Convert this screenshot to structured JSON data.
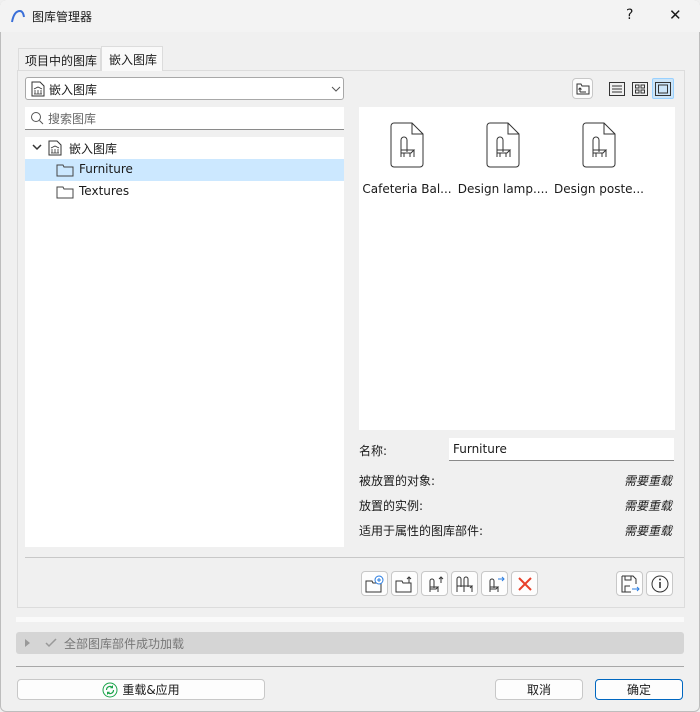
{
  "window": {
    "title": "图库管理器",
    "help": "?",
    "close": "✕"
  },
  "tabs": [
    {
      "label": "项目中的图库",
      "active": false
    },
    {
      "label": "嵌入图库",
      "active": true
    }
  ],
  "library_select": {
    "value": "嵌入图库"
  },
  "search": {
    "placeholder": "搜索图库"
  },
  "tree": {
    "root": "嵌入图库",
    "children": [
      {
        "label": "Furniture",
        "selected": true
      },
      {
        "label": "Textures",
        "selected": false
      }
    ]
  },
  "preview_items": [
    {
      "label": "Cafeteria Bal..."
    },
    {
      "label": "Design lamp...."
    },
    {
      "label": "Design poste..."
    }
  ],
  "details": {
    "name_label": "名称:",
    "name_value": "Furniture",
    "rows": [
      {
        "label": "被放置的对象:",
        "value": "需要重载"
      },
      {
        "label": "放置的实例:",
        "value": "需要重载"
      },
      {
        "label": "适用于属性的图库部件:",
        "value": "需要重载"
      }
    ]
  },
  "status": {
    "text": "全部图库部件成功加载"
  },
  "buttons": {
    "reload": "重载&应用",
    "cancel": "取消",
    "ok": "确定"
  },
  "colors": {
    "selection": "#cce8ff",
    "accent": "#0067c0",
    "delete": "#e8402a",
    "reload_icon": "#1aa34a"
  }
}
